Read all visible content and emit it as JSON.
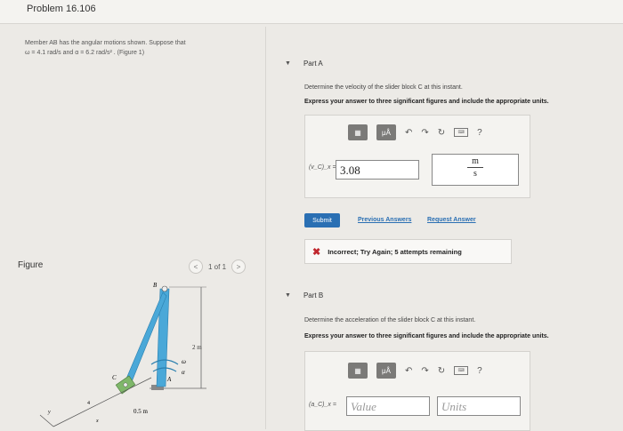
{
  "header": {
    "title": "Problem 16.106"
  },
  "problem": {
    "line1": "Member AB has the angular motions shown. Suppose that",
    "line2": "ω = 4.1  rad/s and α = 6.2  rad/s² . (Figure 1)"
  },
  "figure": {
    "label": "Figure",
    "pager_text": "1 of 1",
    "dims": {
      "height": "2 m",
      "base": "0.5 m"
    },
    "points": {
      "A": "A",
      "B": "B",
      "C": "C",
      "omega": "ω",
      "alpha": "α",
      "x": "x",
      "y": "y",
      "angle": "4"
    }
  },
  "partA": {
    "label": "Part A",
    "question": "Determine the velocity of the slider block C at this instant.",
    "instruction": "Express your answer to three significant figures and include the appropriate units.",
    "var_label": "(v_C)_x =",
    "value": "3.08",
    "units_num": "m",
    "units_den": "s",
    "submit": "Submit",
    "prev_answers": "Previous Answers",
    "request_answer": "Request Answer",
    "feedback": "Incorrect; Try Again; 5 attempts remaining"
  },
  "partB": {
    "label": "Part B",
    "question": "Determine the acceleration of the slider block C at this instant.",
    "instruction": "Express your answer to three significant figures and include the appropriate units.",
    "var_label": "(a_C)_x =",
    "value_placeholder": "Value",
    "units_placeholder": "Units"
  },
  "toolbar": {
    "mu": "μÅ",
    "help": "?"
  }
}
